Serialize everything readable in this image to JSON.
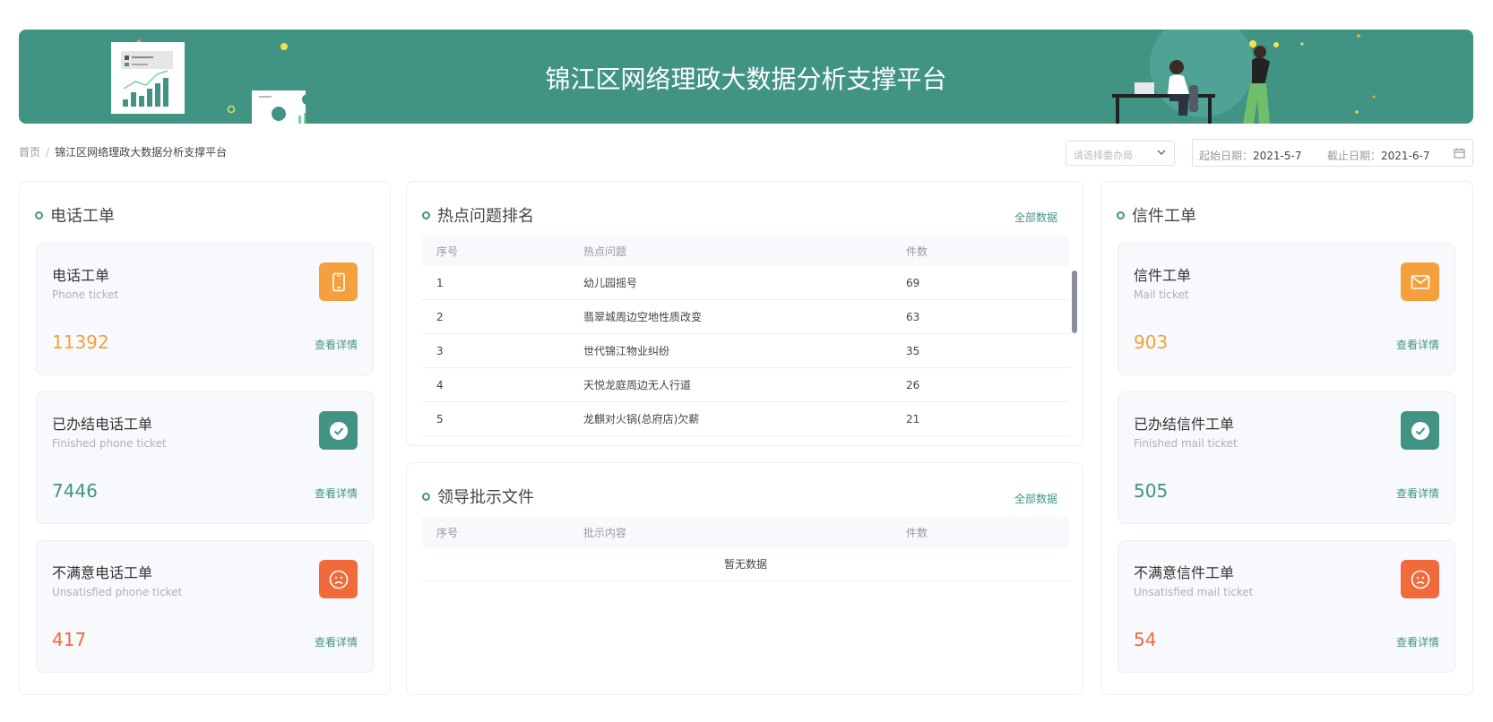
{
  "banner": {
    "title": "锦江区网络理政大数据分析支撑平台"
  },
  "breadcrumb": {
    "home": "首页",
    "separator": "/",
    "current": "锦江区网络理政大数据分析支撑平台"
  },
  "filters": {
    "dept_placeholder": "请选择委办局",
    "start_label": "起始日期：",
    "start_value": "2021-5-7",
    "end_label": "截止日期：",
    "end_value": "2021-6-7"
  },
  "phone_panel": {
    "title": "电话工单",
    "cards": [
      {
        "title": "电话工单",
        "subtitle": "Phone ticket",
        "value": "11392",
        "link": "查看详情",
        "icon": "phone-icon",
        "color": "#f5a03c"
      },
      {
        "title": "已办结电话工单",
        "subtitle": "Finished phone ticket",
        "value": "7446",
        "link": "查看详情",
        "icon": "check-icon",
        "color": "#419484"
      },
      {
        "title": "不满意电话工单",
        "subtitle": "Unsatisfied phone ticket",
        "value": "417",
        "link": "查看详情",
        "icon": "sad-face-icon",
        "color": "#f06a3c"
      }
    ]
  },
  "mail_panel": {
    "title": "信件工单",
    "cards": [
      {
        "title": "信件工单",
        "subtitle": "Mail ticket",
        "value": "903",
        "link": "查看详情",
        "icon": "mail-icon",
        "color": "#f5a03c"
      },
      {
        "title": "已办结信件工单",
        "subtitle": "Finished mail ticket",
        "value": "505",
        "link": "查看详情",
        "icon": "check-icon",
        "color": "#419484"
      },
      {
        "title": "不满意信件工单",
        "subtitle": "Unsatisfied mail ticket",
        "value": "54",
        "link": "查看详情",
        "icon": "sad-face-icon",
        "color": "#f06a3c"
      }
    ]
  },
  "hot_panel": {
    "title": "热点问题排名",
    "all_link": "全部数据",
    "columns": [
      "序号",
      "热点问题",
      "件数"
    ],
    "rows": [
      [
        "1",
        "幼儿园摇号",
        "69"
      ],
      [
        "2",
        "翡翠城周边空地性质改变",
        "63"
      ],
      [
        "3",
        "世代锦江物业纠纷",
        "35"
      ],
      [
        "4",
        "天悦龙庭周边无人行道",
        "26"
      ],
      [
        "5",
        "龙麒对火锅(总府店)欠薪",
        "21"
      ]
    ]
  },
  "docs_panel": {
    "title": "领导批示文件",
    "all_link": "全部数据",
    "columns": [
      "序号",
      "批示内容",
      "件数"
    ],
    "empty_text": "暂无数据"
  }
}
